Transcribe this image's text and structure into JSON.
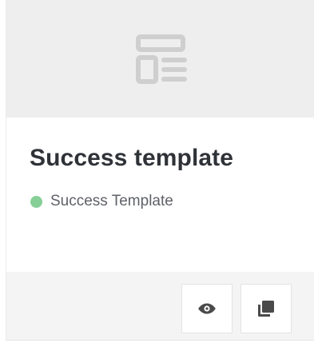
{
  "card": {
    "thumbnail_icon": "template-layout-icon",
    "title": "Success template",
    "status": {
      "label": "Success Template",
      "color": "#86cf97"
    },
    "actions": [
      {
        "name": "preview-button",
        "icon": "eye-icon"
      },
      {
        "name": "duplicate-button",
        "icon": "copy-icon"
      }
    ]
  }
}
